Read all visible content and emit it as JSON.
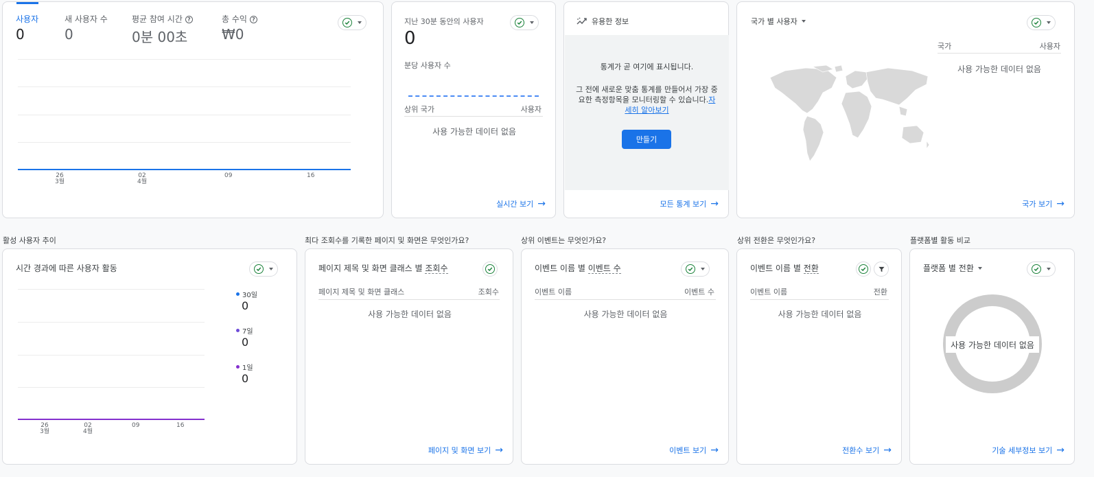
{
  "overview": {
    "tabs": [
      {
        "label": "사용자",
        "value": "0"
      },
      {
        "label": "새 사용자 수",
        "value": "0"
      },
      {
        "label": "평균 참여 시간",
        "value": "0분 00초"
      },
      {
        "label": "총 수익",
        "value": "₩0"
      }
    ],
    "x_ticks": [
      {
        "day": "26",
        "month": "3월"
      },
      {
        "day": "02",
        "month": "4월"
      },
      {
        "day": "09",
        "month": ""
      },
      {
        "day": "16",
        "month": ""
      }
    ]
  },
  "realtime": {
    "title": "지난 30분 동안의 사용자",
    "value": "0",
    "per_minute": "분당 사용자 수",
    "col_country": "상위 국가",
    "col_users": "사용자",
    "no_data": "사용 가능한 데이터 없음",
    "link": "실시간 보기"
  },
  "insights": {
    "title": "유용한 정보",
    "line1": "통계가 곧 여기에 표시됩니다.",
    "line2": "그 전에 새로운 맞춤 통계를 만들어서 가장 중요한 측정항목을 모니터링할 수 있습니다.",
    "learn_more": "자세히 알아보기",
    "create": "만들기",
    "link": "모든 통계 보기"
  },
  "country": {
    "title": "국가 별 사용자",
    "col_country": "국가",
    "col_users": "사용자",
    "no_data": "사용 가능한 데이터 없음",
    "link": "국가 보기"
  },
  "sections": {
    "active": "활성 사용자 추이",
    "pages": "최다 조회수를 기록한 페이지 및 화면은 무엇인가요?",
    "events": "상위 이벤트는 무엇인가요?",
    "conversions": "상위 전환은 무엇인가요?",
    "platform": "플랫폼별 활동 비교"
  },
  "active": {
    "title": "시간 경과에 따른 사용자 활동",
    "legend": [
      {
        "label": "30일",
        "value": "0",
        "color": "#1a73e8"
      },
      {
        "label": "7일",
        "value": "0",
        "color": "#6d4bd8"
      },
      {
        "label": "1일",
        "value": "0",
        "color": "#8430ce"
      }
    ],
    "x_ticks": [
      {
        "day": "26",
        "month": "3월"
      },
      {
        "day": "02",
        "month": "4월"
      },
      {
        "day": "09",
        "month": ""
      },
      {
        "day": "16",
        "month": ""
      }
    ]
  },
  "pages": {
    "title_prefix": "페이지 제목 및 화면 클래스 별 ",
    "title_metric": "조회수",
    "col_name": "페이지 제목 및 화면 클래스",
    "col_value": "조회수",
    "no_data": "사용 가능한 데이터 없음",
    "link": "페이지 및 화면 보기"
  },
  "events": {
    "title_prefix": "이벤트 이름 별 ",
    "title_metric": "이벤트 수",
    "col_name": "이벤트 이름",
    "col_value": "이벤트 수",
    "no_data": "사용 가능한 데이터 없음",
    "link": "이벤트 보기"
  },
  "conversions": {
    "title_prefix": "이벤트 이름 별 ",
    "title_metric": "전환",
    "col_name": "이벤트 이름",
    "col_value": "전환",
    "no_data": "사용 가능한 데이터 없음",
    "link": "전환수 보기"
  },
  "platform": {
    "title": "플랫폼 별 전환",
    "no_data": "사용 가능한 데이터 없음",
    "link": "기술 세부정보 보기"
  },
  "colors": {
    "accent": "#1a73e8",
    "check": "#188038",
    "donut": "#cccccc"
  }
}
